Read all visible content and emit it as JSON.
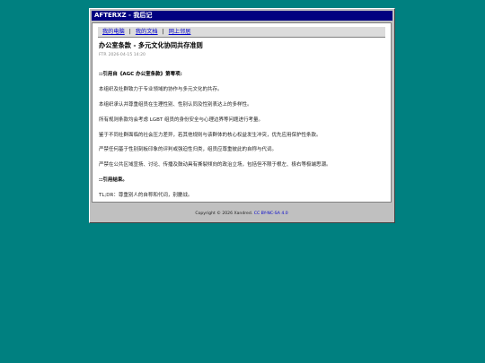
{
  "window": {
    "title": "AFTERXZ - 我后记"
  },
  "nav": {
    "items": [
      "我的电脑",
      "我的文档",
      "网上邻居"
    ],
    "separator": "|"
  },
  "article": {
    "title": "办公室条款 - 多元文化协同共存准则",
    "author": "FTR",
    "date": "2026-04-15 14:20",
    "paragraphs": [
      "::引用自《AGC 办公室条款》第零项:",
      "本组织及社群致力于专业领域的协作与多元文化的共存。",
      "本组织承认并尊重组员在生理性别、性别认同及性别表达上的多样性。",
      "所有规则条款均会考虑 LGBT 组员的身份安全与心理边界等问题进行考量。",
      "鉴于不同社群面临的社会压力差异，若其他规则与该群体的核心权益发生冲突，优先应用保护性条款。",
      "严禁任何基于性别刻板印象的评判或强迫性归类，组员应尊重彼此的自称与代词。",
      "严禁在公共区域宣扬、讨论、传播及鼓动具有撕裂倾向的政治立场，包括但不限于根左、极右等极端思潮。",
      "::引用结束。",
      "TL;DR：尊重别人的自称和代词，别鏖战。"
    ]
  },
  "footer": {
    "copyright": "Copyright © 2026 Xandred.",
    "license_label": "CC BY-NC-SA 4.0"
  },
  "colors": {
    "desktop": "#008080",
    "titlebar": "#000080",
    "link": "#0000cc"
  }
}
